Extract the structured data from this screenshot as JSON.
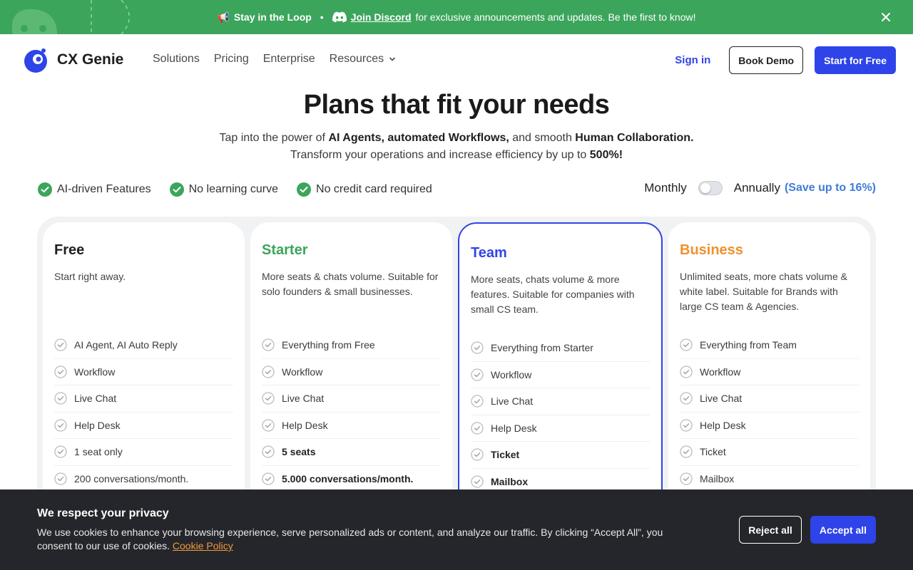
{
  "announcement": {
    "lead": "Stay in the Loop",
    "separator": "•",
    "link": "Join Discord",
    "rest": "for exclusive announcements and updates. Be the first to know!"
  },
  "brand": {
    "name": "CX Genie"
  },
  "nav": {
    "solutions": "Solutions",
    "pricing": "Pricing",
    "enterprise": "Enterprise",
    "resources": "Resources",
    "sign_in": "Sign in",
    "book_demo": "Book Demo",
    "start_free": "Start for Free"
  },
  "hero": {
    "title": "Plans that fit your needs",
    "line1_a": "Tap into the power of ",
    "line1_b": "AI Agents, automated Workflows,",
    "line1_c": " and smooth ",
    "line1_d": "Human Collaboration.",
    "line2_a": "Transform your operations and increase efficiency by up to ",
    "line2_b": "500%!"
  },
  "features": [
    "AI-driven Features",
    "No learning curve",
    "No credit card required"
  ],
  "billing": {
    "monthly": "Monthly",
    "annually": "Annually",
    "save": "(Save up to 16%)"
  },
  "plans": [
    {
      "name": "Free",
      "color": "#1f1f1f",
      "desc": "Start right away.",
      "items": [
        {
          "t": "AI Agent, AI Auto Reply",
          "b": false
        },
        {
          "t": "Workflow",
          "b": false
        },
        {
          "t": "Live Chat",
          "b": false
        },
        {
          "t": "Help Desk",
          "b": false
        },
        {
          "t": "1 seat only",
          "b": false
        },
        {
          "t": "200 conversations/month.",
          "b": false
        }
      ]
    },
    {
      "name": "Starter",
      "color": "#3ca55c",
      "desc": "More seats & chats volume. Suitable for solo founders & small businesses.",
      "items": [
        {
          "t": "Everything from Free",
          "b": false
        },
        {
          "t": "Workflow",
          "b": false
        },
        {
          "t": "Live Chat",
          "b": false
        },
        {
          "t": "Help Desk",
          "b": false
        },
        {
          "t": "5 seats",
          "b": true
        },
        {
          "t": "5.000 conversations/month.",
          "b": true
        }
      ]
    },
    {
      "name": "Team",
      "color": "#3144e6",
      "desc": "More seats, chats volume & more features. Suitable for companies with small CS team.",
      "items": [
        {
          "t": "Everything from Starter",
          "b": false
        },
        {
          "t": "Workflow",
          "b": false
        },
        {
          "t": "Live Chat",
          "b": false
        },
        {
          "t": "Help Desk",
          "b": false
        },
        {
          "t": "Ticket",
          "b": true
        },
        {
          "t": "Mailbox",
          "b": true
        }
      ]
    },
    {
      "name": "Business",
      "color": "#f0912c",
      "desc": "Unlimited seats, more chats volume & white label. Suitable for Brands with large CS team & Agencies.",
      "items": [
        {
          "t": "Everything from Team",
          "b": false
        },
        {
          "t": "Workflow",
          "b": false
        },
        {
          "t": "Live Chat",
          "b": false
        },
        {
          "t": "Help Desk",
          "b": false
        },
        {
          "t": "Ticket",
          "b": false
        },
        {
          "t": "Mailbox",
          "b": false
        }
      ]
    }
  ],
  "cookie": {
    "title": "We respect your privacy",
    "text": "We use cookies to enhance your browsing experience, serve personalized ads or content, and analyze our traffic. By clicking “Accept All”, you consent to our use of cookies. ",
    "policy": "Cookie Policy",
    "reject": "Reject all",
    "accept": "Accept all"
  },
  "colors": {
    "accent": "#2e44e8",
    "announce_bg": "#3ca55c",
    "check_green": "#3ca55c",
    "cookie_bg": "#25262b"
  }
}
